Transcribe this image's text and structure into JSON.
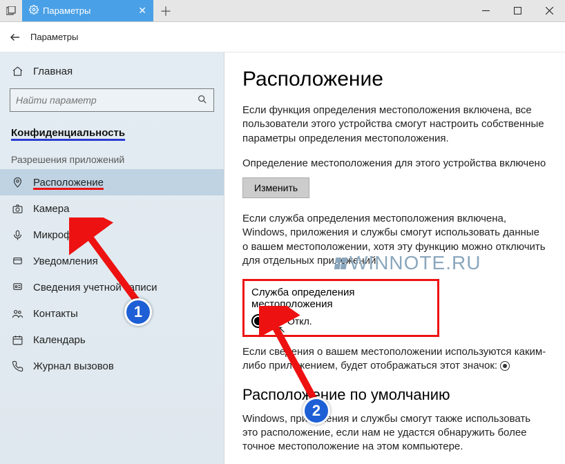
{
  "titlebar": {
    "tab_label": "Параметры"
  },
  "topbar": {
    "title": "Параметры"
  },
  "sidebar": {
    "home": "Главная",
    "search_placeholder": "Найти параметр",
    "heading": "Конфиденциальность",
    "subheading": "Разрешения приложений",
    "items": [
      {
        "label": "Расположение"
      },
      {
        "label": "Камера"
      },
      {
        "label": "Микрофон"
      },
      {
        "label": "Уведомления"
      },
      {
        "label": "Сведения учетной записи"
      },
      {
        "label": "Контакты"
      },
      {
        "label": "Календарь"
      },
      {
        "label": "Журнал вызовов"
      }
    ]
  },
  "content": {
    "h1": "Расположение",
    "p1": "Если функция определения местоположения включена, все пользователи этого устройства смогут настроить собственные параметры определения местоположения.",
    "status_line": "Определение местоположения для этого устройства включено",
    "change_btn": "Изменить",
    "p2": "Если служба определения местоположения включена, Windows, приложения и службы смогут использовать данные о вашем местоположении, хотя эту функцию можно отключить для отдельных приложений.",
    "toggle_label": "Служба определения местоположения",
    "toggle_state": "Откл.",
    "p3": "Если сведения о вашем местоположении используются каким-либо приложением, будет отображаться этот значок: ",
    "h2": "Расположение по умолчанию",
    "p4": "Windows, приложения и службы смогут также использовать это расположение, если нам не удастся обнаружить более точное местоположение на этом компьютере."
  },
  "watermark": "WINNOTE.RU",
  "badges": {
    "one": "1",
    "two": "2"
  }
}
